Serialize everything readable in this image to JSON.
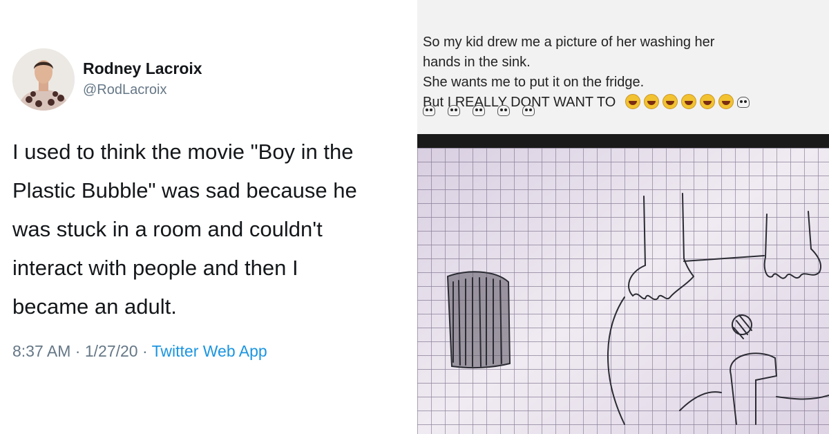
{
  "tweet": {
    "display_name": "Rodney Lacroix",
    "handle": "@RodLacroix",
    "text": "I used to think the movie \"Boy in the\nPlastic Bubble\" was sad because he\nwas stuck in a room and couldn't\ninteract with people and then I\nbecame an adult.",
    "time": "8:37 AM",
    "date": "1/27/20",
    "separator": "·",
    "source_app": "Twitter Web App"
  },
  "post": {
    "text": "So my kid drew me a picture of her washing her\nhands in the sink.\nShe wants me to put it on the fridge.",
    "last_line": "But I REALLY DONT WANT TO",
    "emoji_icons": [
      "laughing-emoji",
      "laughing-emoji",
      "laughing-emoji",
      "laughing-emoji",
      "laughing-emoji",
      "laughing-emoji",
      "skull-emoji"
    ],
    "second_row_icons": [
      "skull-emoji",
      "skull-emoji",
      "skull-emoji",
      "skull-emoji",
      "skull-emoji"
    ]
  },
  "colors": {
    "link": "#1b95e0",
    "secondary_text": "#657786",
    "primary_text": "#14171a",
    "paper": "#e6dfea",
    "grid": "#6b5f7c"
  }
}
